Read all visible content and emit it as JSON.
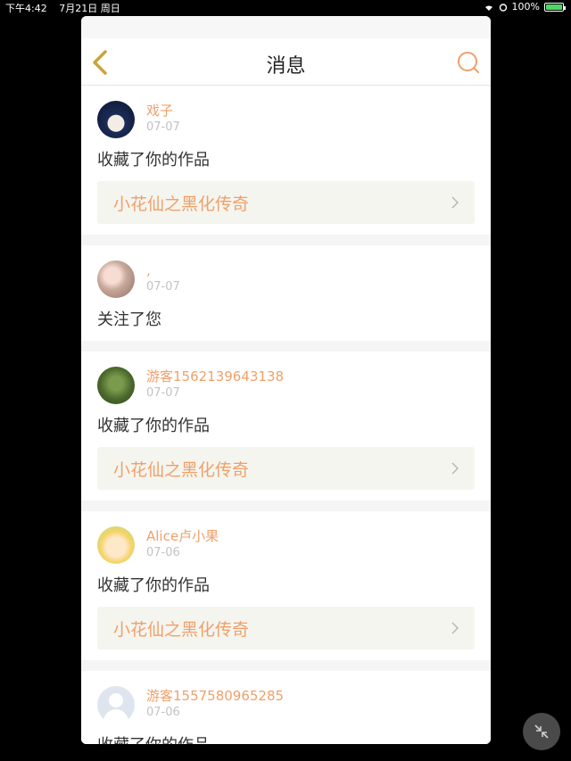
{
  "status_bar": {
    "time": "下午4:42",
    "date": "7月21日 周日",
    "battery": "100%",
    "battery_level": 1.0
  },
  "nav": {
    "title": "消息",
    "back_icon": "chevron-left-icon",
    "search_icon": "search-icon"
  },
  "messages": [
    {
      "user": "戏子",
      "date": "07-07",
      "action": "收藏了你的作品",
      "work": "小花仙之黑化传奇"
    },
    {
      "user": ",",
      "date": "07-07",
      "action": "关注了您",
      "work": ""
    },
    {
      "user": "游客1562139643138",
      "date": "07-07",
      "action": "收藏了你的作品",
      "work": "小花仙之黑化传奇"
    },
    {
      "user": "Alice卢小果",
      "date": "07-06",
      "action": "收藏了你的作品",
      "work": "小花仙之黑化传奇"
    },
    {
      "user": "游客1557580965285",
      "date": "07-06",
      "action": "收藏了你的作品",
      "work": ""
    }
  ],
  "colors": {
    "accent": "#f0a06a",
    "back_icon": "#c9a43c",
    "date": "#c2c2c2",
    "work_bg": "#f5f5ef"
  }
}
